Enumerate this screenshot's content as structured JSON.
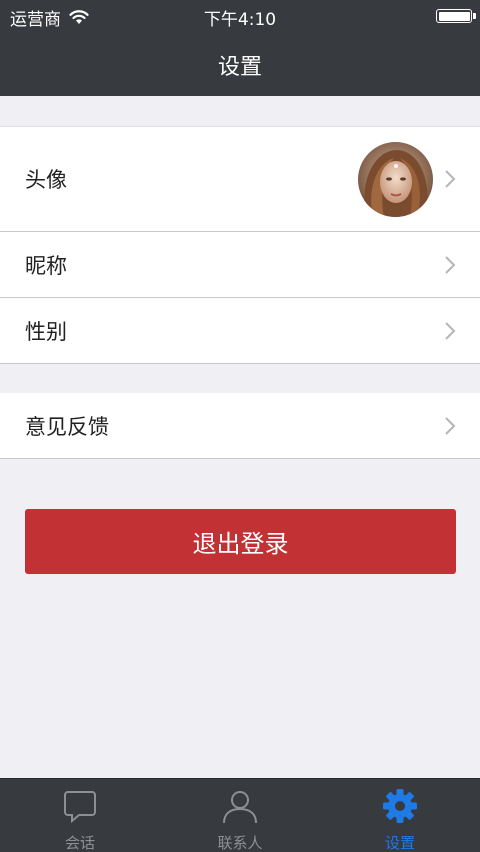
{
  "status_bar": {
    "carrier": "运营商",
    "time": "下午4:10",
    "battery_level": 1.0
  },
  "nav": {
    "title": "设置"
  },
  "rows": {
    "avatar": "头像",
    "nickname": "昵称",
    "gender": "性别",
    "feedback": "意见反馈"
  },
  "logout_label": "退出登录",
  "tabs": [
    {
      "label": "会话",
      "icon": "chat-bubble-icon",
      "active": false
    },
    {
      "label": "联系人",
      "icon": "person-icon",
      "active": false
    },
    {
      "label": "设置",
      "icon": "gear-icon",
      "active": true
    }
  ],
  "colors": {
    "bar_bg": "#373a3e",
    "accent": "#1e7be6",
    "logout": "#c23134",
    "page_bg": "#efeff4"
  }
}
